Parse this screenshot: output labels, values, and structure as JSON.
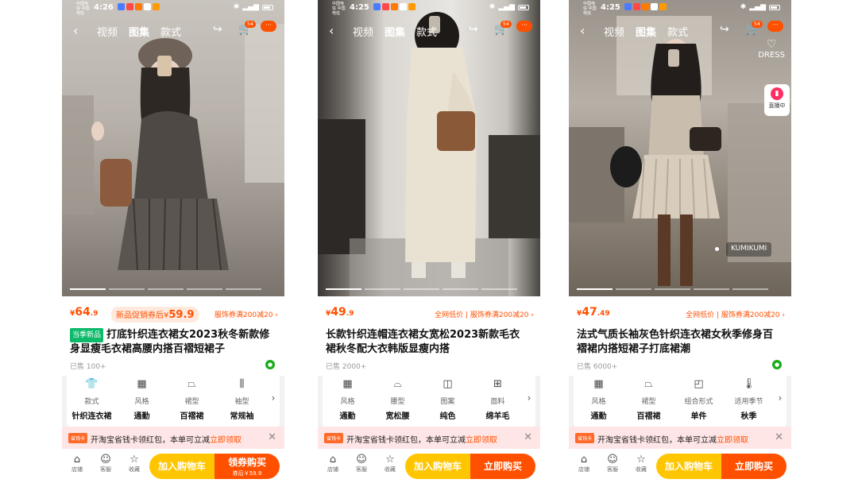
{
  "colors": {
    "accent": "#ff5000",
    "cart_yellow": "#ffc600",
    "new_green": "#0cba6a",
    "banner_bg": "#ffe6e6"
  },
  "phones": [
    {
      "status": {
        "carrier": "中国电信 中国电信",
        "time": "4:26"
      },
      "nav": {
        "tabs": [
          "视频",
          "图集",
          "款式"
        ],
        "active_tab": "图集",
        "cart_badge": "54"
      },
      "price_symbol": "¥",
      "price": "64",
      "price_decimal": ".9",
      "promo_label": "新品促销券后",
      "promo_symbol": "¥",
      "promo_price": "59.9",
      "coupon": "服饰券满200减20 ›",
      "title_tag": "当季新品",
      "title": "打底针织连衣裙女2023秋冬新款修身显瘦毛衣裙高腰内搭百褶短裙子",
      "sold": "已售 100+",
      "attrs": [
        {
          "icon": "sweater-icon",
          "key": "款式",
          "value": "针织连衣裙"
        },
        {
          "icon": "style-icon",
          "key": "风格",
          "value": "通勤"
        },
        {
          "icon": "skirt-icon",
          "key": "裙型",
          "value": "百褶裙"
        },
        {
          "icon": "sleeve-icon",
          "key": "袖型",
          "value": "常规袖"
        }
      ],
      "banner": {
        "tag": "省钱卡",
        "text": "开淘宝省钱卡领红包，本单可立减",
        "link": "立即领取"
      },
      "bottom_icons": [
        "店铺",
        "客服",
        "收藏"
      ],
      "btn_cart": "加入购物车",
      "btn_buy": "领券购买",
      "btn_buy_sub": "券后￥59.9"
    },
    {
      "status": {
        "carrier": "中国电信 中国电信",
        "time": "4:25"
      },
      "nav": {
        "tabs": [
          "视频",
          "图集",
          "款式"
        ],
        "active_tab": "图集",
        "cart_badge": "54"
      },
      "price_symbol": "¥",
      "price": "49",
      "price_decimal": ".9",
      "coupon": "全网低价 | 服饰券满200减20 ›",
      "title": "长款针织连帽连衣裙女宽松2023新款毛衣裙秋冬配大衣韩版显瘦内搭",
      "sold": "已售 2000+",
      "attrs": [
        {
          "icon": "style-icon",
          "key": "风格",
          "value": "通勤"
        },
        {
          "icon": "waist-icon",
          "key": "腰型",
          "value": "宽松腰"
        },
        {
          "icon": "pattern-icon",
          "key": "图案",
          "value": "纯色"
        },
        {
          "icon": "fabric-icon",
          "key": "面料",
          "value": "绵羊毛"
        }
      ],
      "banner": {
        "tag": "省钱卡",
        "text": "开淘宝省钱卡领红包，本单可立减",
        "link": "立即领取"
      },
      "bottom_icons": [
        "店铺",
        "客服",
        "收藏"
      ],
      "btn_cart": "加入购物车",
      "btn_buy": "立即购买"
    },
    {
      "status": {
        "carrier": "中国电信 中国电信",
        "time": "4:25"
      },
      "nav": {
        "tabs": [
          "视频",
          "图集",
          "款式"
        ],
        "active_tab": "图集",
        "cart_badge": "54"
      },
      "side_label": "DRESS",
      "live_label": "直播中",
      "model_tag": "KUMIKUMI",
      "price_symbol": "¥",
      "price": "47",
      "price_decimal": ".49",
      "coupon": "全网低价 | 服饰券满200减20 ›",
      "title": "法式气质长袖灰色针织连衣裙女秋季修身百褶裙内搭短裙子打底裙潮",
      "sold": "已售 6000+",
      "attrs": [
        {
          "icon": "style-icon",
          "key": "风格",
          "value": "通勤"
        },
        {
          "icon": "skirt-icon",
          "key": "裙型",
          "value": "百褶裙"
        },
        {
          "icon": "set-icon",
          "key": "组合形式",
          "value": "单件"
        },
        {
          "icon": "season-icon",
          "key": "适用季节",
          "value": "秋季"
        }
      ],
      "banner": {
        "tag": "省钱卡",
        "text": "开淘宝省钱卡领红包，本单可立减",
        "link": "立即领取"
      },
      "bottom_icons": [
        "店铺",
        "客服",
        "收藏"
      ],
      "btn_cart": "加入购物车",
      "btn_buy": "立即购买"
    }
  ]
}
